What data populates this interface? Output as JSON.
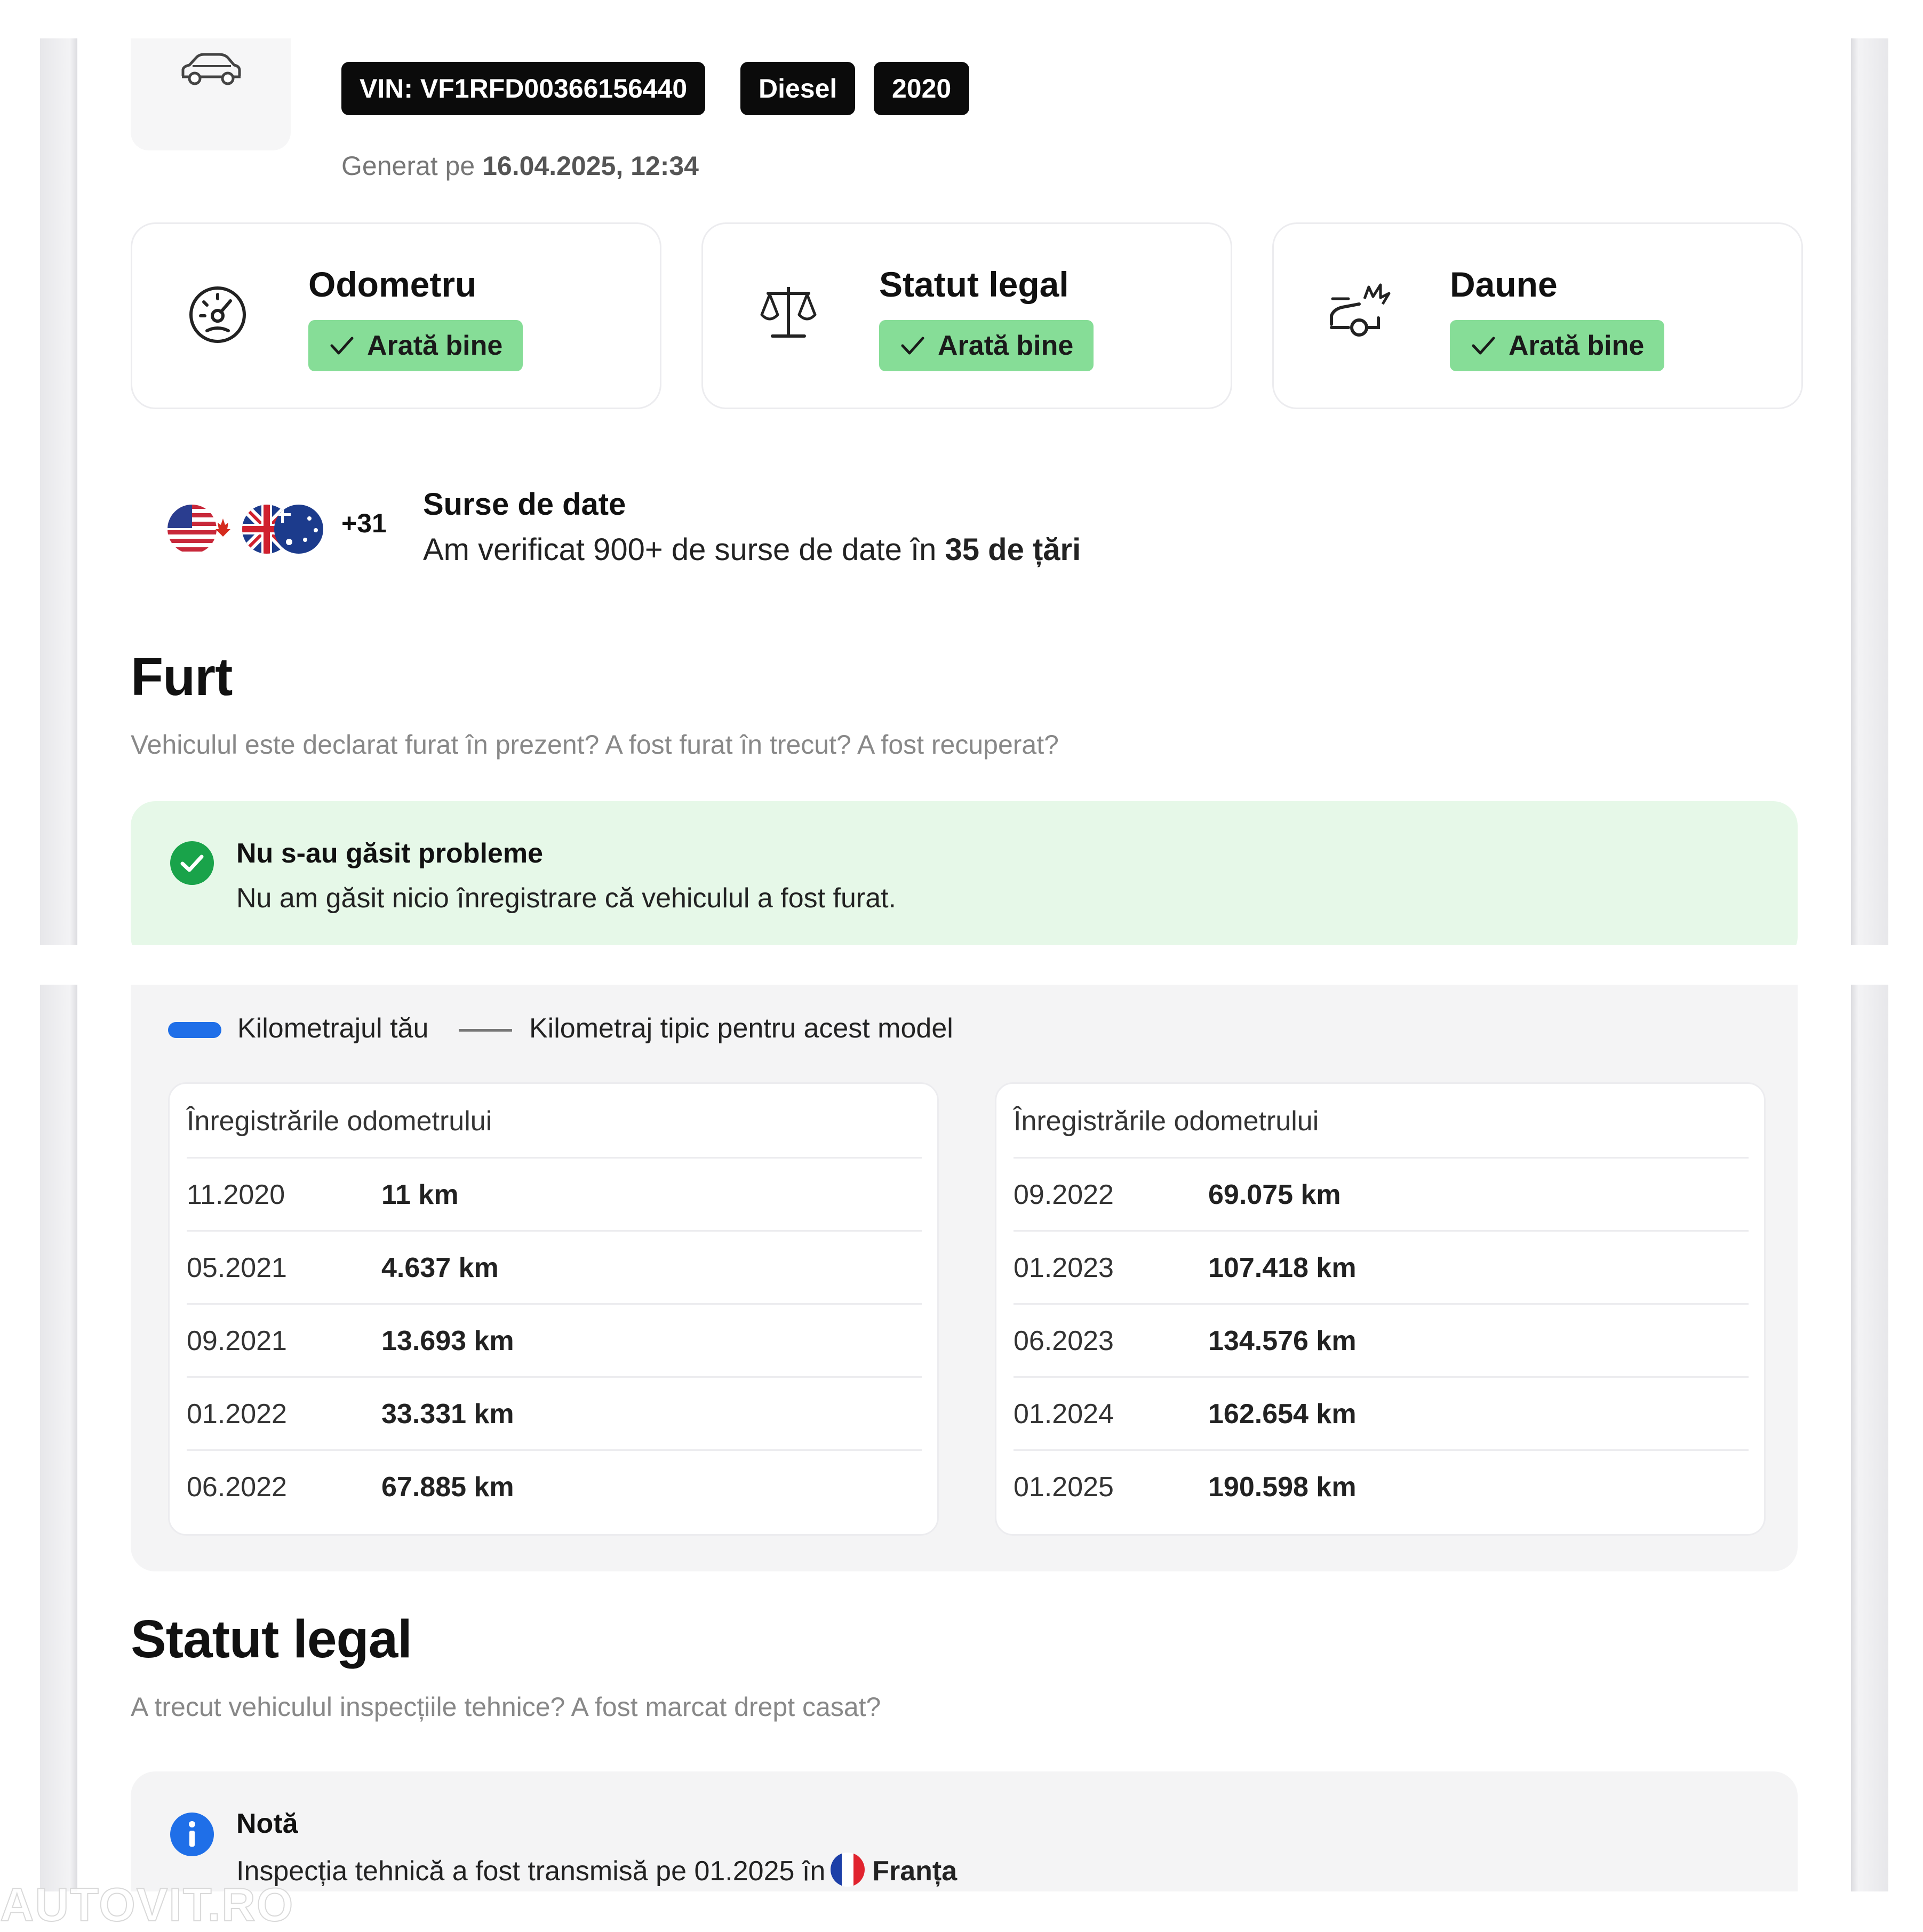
{
  "vehicle": {
    "vin_tag": "VIN: VF1RFD00366156440",
    "fuel_tag": "Diesel",
    "year_tag": "2020",
    "generated_prefix": "Generat pe",
    "generated_date": "16.04.2025, 12:34"
  },
  "summary_cards": [
    {
      "title": "Odometru",
      "status": "Arată bine",
      "icon": "speedometer-icon"
    },
    {
      "title": "Statut legal",
      "status": "Arată bine",
      "icon": "scales-icon"
    },
    {
      "title": "Daune",
      "status": "Arată bine",
      "icon": "car-crash-icon"
    }
  ],
  "sources": {
    "extra_count": "+31",
    "title": "Surse de date",
    "text_prefix": "Am verificat 900+ de surse de date în",
    "text_bold": "35 de țări"
  },
  "theft": {
    "heading": "Furt",
    "question": "Vehiculul este declarat furat în prezent? A fost furat în trecut? A fost recuperat?",
    "result_title": "Nu s-au găsit probleme",
    "result_text": "Nu am găsit nicio înregistrare că vehiculul a fost furat."
  },
  "odometer": {
    "legend_yours": "Kilometrajul tău",
    "legend_typical": "Kilometraj tipic pentru acest model",
    "tables": [
      {
        "header": "Înregistrările odometrului",
        "rows": [
          {
            "date": "11.2020",
            "km": "11 km"
          },
          {
            "date": "05.2021",
            "km": "4.637 km"
          },
          {
            "date": "09.2021",
            "km": "13.693 km"
          },
          {
            "date": "01.2022",
            "km": "33.331 km"
          },
          {
            "date": "06.2022",
            "km": "67.885 km"
          }
        ]
      },
      {
        "header": "Înregistrările odometrului",
        "rows": [
          {
            "date": "09.2022",
            "km": "69.075 km"
          },
          {
            "date": "01.2023",
            "km": "107.418 km"
          },
          {
            "date": "06.2023",
            "km": "134.576 km"
          },
          {
            "date": "01.2024",
            "km": "162.654 km"
          },
          {
            "date": "01.2025",
            "km": "190.598 km"
          }
        ]
      }
    ]
  },
  "legal": {
    "heading": "Statut legal",
    "question": "A trecut vehiculul inspecțiile tehnice? A fost marcat drept casat?",
    "note_title": "Notă",
    "note_text": "Inspecția tehnică a fost transmisă pe 01.2025 în",
    "note_country": "Franța"
  },
  "watermark": "AUTOVIT.RO",
  "colors": {
    "ok_green": "#86dd97",
    "ok_bg": "#e6f8e8",
    "check_circle": "#19a34a",
    "info_blue": "#1f6fe8",
    "tag_black": "#0b0b0b"
  }
}
